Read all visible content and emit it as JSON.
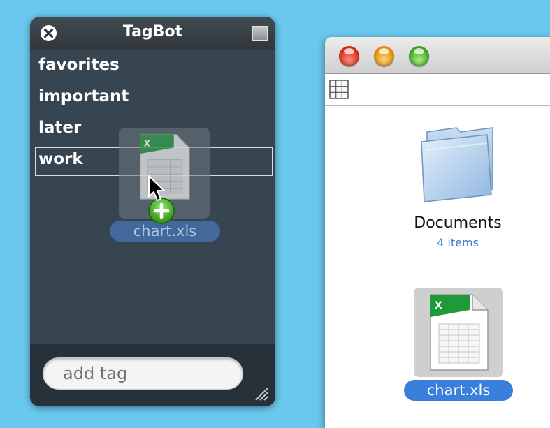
{
  "tagbot": {
    "title": "TagBot",
    "tags": [
      "favorites",
      "important",
      "later",
      "work"
    ],
    "highlighted_tag": "work",
    "add_tag_placeholder": "add tag"
  },
  "finder": {
    "folder": {
      "name": "Documents",
      "count": "4 items"
    },
    "file": {
      "name": "chart.xls"
    }
  },
  "drag": {
    "file_label": "chart.xls"
  },
  "colors": {
    "desktop": "#6ac8ee",
    "tagbot_bg": "#364550",
    "selection_blue": "#3a7fdc",
    "folder_count": "#3f78cc"
  }
}
